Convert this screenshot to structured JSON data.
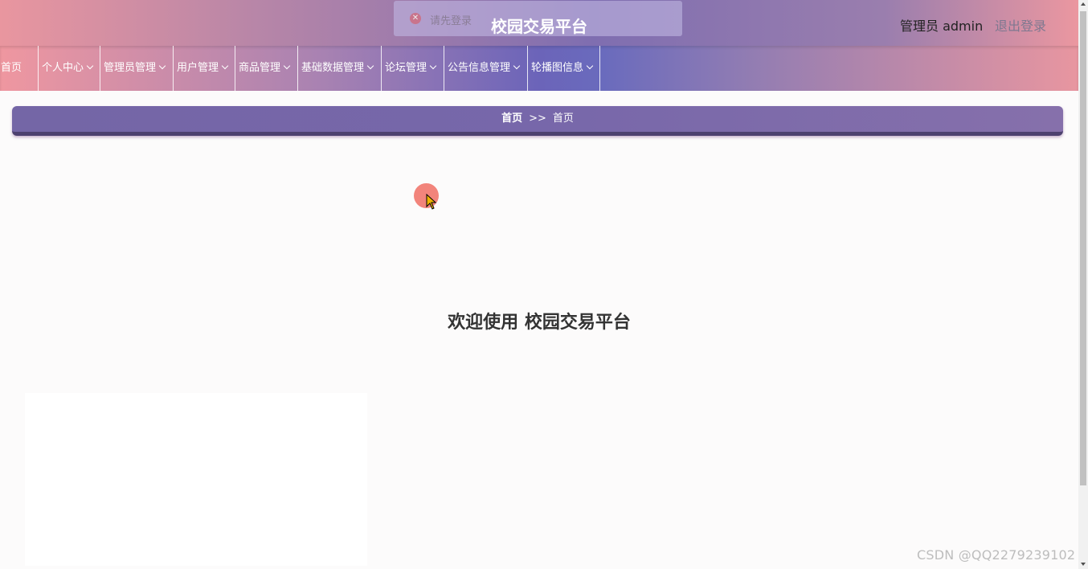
{
  "header": {
    "title": "校园交易平台",
    "admin_label": "管理员 admin",
    "logout_label": "退出登录"
  },
  "toast": {
    "message": "请先登录",
    "icon": "close-circle-icon"
  },
  "nav": {
    "items": [
      {
        "label": "首页",
        "has_dropdown": false
      },
      {
        "label": "个人中心",
        "has_dropdown": true
      },
      {
        "label": "管理员管理",
        "has_dropdown": true
      },
      {
        "label": "用户管理",
        "has_dropdown": true
      },
      {
        "label": "商品管理",
        "has_dropdown": true
      },
      {
        "label": "基础数据管理",
        "has_dropdown": true
      },
      {
        "label": "论坛管理",
        "has_dropdown": true
      },
      {
        "label": "公告信息管理",
        "has_dropdown": true
      },
      {
        "label": "轮播图信息",
        "has_dropdown": true
      }
    ]
  },
  "breadcrumb": {
    "home": "首页",
    "separator": ">>",
    "current": "首页"
  },
  "main": {
    "welcome": "欢迎使用 校园交易平台"
  },
  "watermark": "CSDN @QQ2279239102",
  "colors": {
    "header_pink": "#e9969f",
    "header_purple": "#7f6eb0",
    "breadcrumb_bg": "#7466a6",
    "breadcrumb_border": "#4d416f"
  }
}
